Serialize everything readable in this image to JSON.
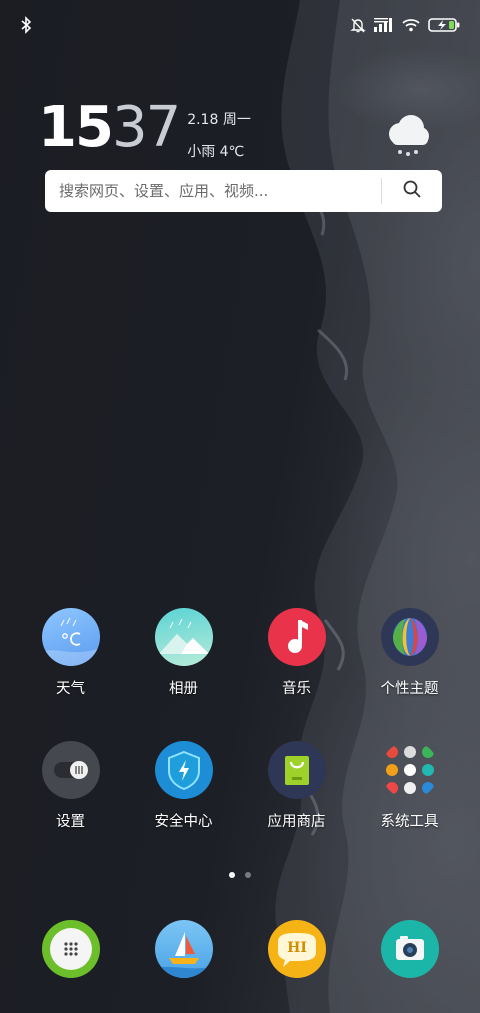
{
  "status_bar": {
    "left_icons": [
      "bluetooth-icon"
    ],
    "right_icons": [
      "mute-bell-icon",
      "signal-icon",
      "wifi-icon",
      "battery-charging-icon"
    ]
  },
  "clock_widget": {
    "hour": "15",
    "minute": "37",
    "date": "2.18 周一",
    "weather": "小雨 4℃",
    "weather_icon": "rain-cloud-icon"
  },
  "search": {
    "placeholder": "搜索网页、设置、应用、视频..."
  },
  "apps": [
    {
      "label": "天气",
      "icon": "weather-icon"
    },
    {
      "label": "相册",
      "icon": "gallery-icon"
    },
    {
      "label": "音乐",
      "icon": "music-icon"
    },
    {
      "label": "个性主题",
      "icon": "themes-icon"
    },
    {
      "label": "设置",
      "icon": "settings-icon"
    },
    {
      "label": "安全中心",
      "icon": "security-icon"
    },
    {
      "label": "应用商店",
      "icon": "app-store-icon"
    },
    {
      "label": "系统工具",
      "icon": "system-tools-folder-icon"
    }
  ],
  "page_indicator": {
    "pages": 2,
    "current": 1
  },
  "dock": [
    {
      "icon": "phone-dialer-icon"
    },
    {
      "icon": "browser-boat-icon"
    },
    {
      "icon": "messaging-hi-icon"
    },
    {
      "icon": "camera-icon"
    }
  ],
  "colors": {
    "music": "#e8334a",
    "themes_bg": "#2f3756",
    "security": "#1d8ed6",
    "dialer_ring": "#6cbf2a",
    "messaging": "#f5b316",
    "camera": "#1cb6a8"
  }
}
